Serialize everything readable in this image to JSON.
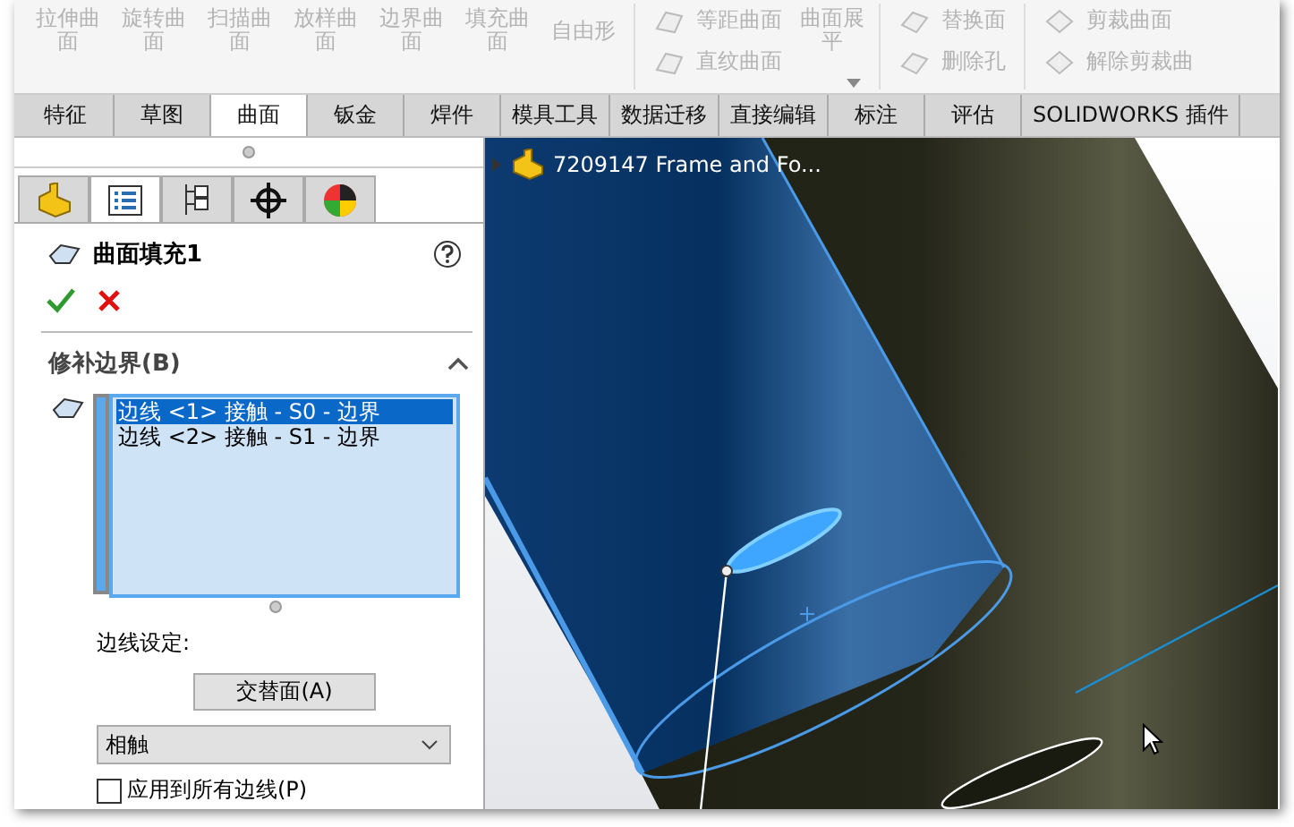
{
  "ribbon": {
    "disabled": true,
    "large_buttons": [
      {
        "label": "拉伸曲面"
      },
      {
        "label": "旋转曲面"
      },
      {
        "label": "扫描曲面"
      },
      {
        "label": "放样曲面"
      },
      {
        "label": "边界曲面"
      },
      {
        "label": "填充曲面"
      },
      {
        "label": "自由形"
      }
    ],
    "group_2": {
      "small_buttons": [
        {
          "label": "等距曲面"
        },
        {
          "label": "直纹曲面"
        }
      ],
      "large_button": {
        "label": "曲面展平"
      }
    },
    "group_3": {
      "small_buttons": [
        {
          "label": "替换面"
        },
        {
          "label": "删除孔"
        }
      ]
    },
    "group_4": {
      "small_buttons": [
        {
          "label": "剪裁曲面"
        },
        {
          "label": "解除剪裁曲"
        }
      ]
    }
  },
  "tabs": [
    {
      "label": "特征",
      "selected": false
    },
    {
      "label": "草图",
      "selected": false
    },
    {
      "label": "曲面",
      "selected": true
    },
    {
      "label": "钣金",
      "selected": false
    },
    {
      "label": "焊件",
      "selected": false
    },
    {
      "label": "模具工具",
      "selected": false
    },
    {
      "label": "数据迁移",
      "selected": false
    },
    {
      "label": "直接编辑",
      "selected": false
    },
    {
      "label": "标注",
      "selected": false
    },
    {
      "label": "评估",
      "selected": false
    },
    {
      "label": "SOLIDWORKS 插件",
      "selected": false
    }
  ],
  "panel": {
    "tabs": [
      {
        "kind": "part",
        "selected": false
      },
      {
        "kind": "properties",
        "selected": true
      },
      {
        "kind": "configuration",
        "selected": false
      },
      {
        "kind": "target",
        "selected": false
      },
      {
        "kind": "appearance",
        "selected": false
      }
    ],
    "feature_title": "曲面填充1",
    "section": {
      "title": "修补边界(B)",
      "expanded": true,
      "boundary_items": [
        {
          "text": "边线 <1> 接触 - S0 - 边界",
          "selected": true
        },
        {
          "text": "边线 <2> 接触 - S1 - 边界",
          "selected": false
        }
      ]
    },
    "edge_settings_label": "边线设定:",
    "alternate_face_button": "交替面(A)",
    "curvature_dropdown": {
      "value": "相触"
    },
    "apply_all_checkbox": {
      "label": "应用到所有边线(P)",
      "checked": false
    }
  },
  "viewport": {
    "tree_item": {
      "label": "7209147 Frame and Fo...",
      "expanded": false
    }
  }
}
